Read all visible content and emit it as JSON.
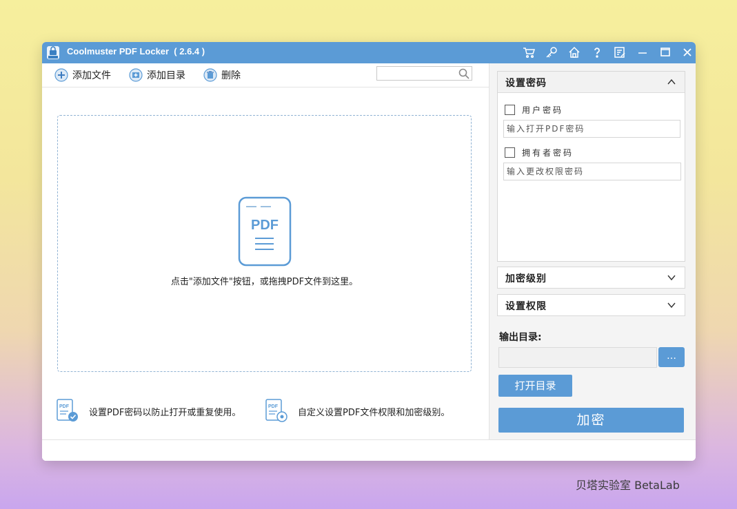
{
  "window": {
    "title": "Coolmuster PDF Locker  ( 2.6.4 )"
  },
  "titlebar_icons": [
    "cart-icon",
    "key-icon",
    "home-icon",
    "help-icon",
    "feedback-icon",
    "minimize-icon",
    "maximize-icon",
    "close-icon"
  ],
  "toolbar": {
    "add_file": "添加文件",
    "add_folder": "添加目录",
    "delete": "删除",
    "search_placeholder": ""
  },
  "dropzone": {
    "pdf_label": "PDF",
    "hint": "点击\"添加文件\"按钮，或拖拽PDF文件到这里。"
  },
  "features": [
    {
      "text": "设置PDF密码以防止打开或重复使用。"
    },
    {
      "text": "自定义设置PDF文件权限和加密级别。"
    }
  ],
  "panels": {
    "set_password": {
      "title": "设置密码",
      "user_password_label": "用户密码",
      "user_password_placeholder": "输入打开PDF密码",
      "owner_password_label": "拥有者密码",
      "owner_password_placeholder": "输入更改权限密码"
    },
    "encryption_level": {
      "title": "加密级别"
    },
    "permissions": {
      "title": "设置权限"
    }
  },
  "output": {
    "label": "输出目录:",
    "value": "",
    "browse_label": "…",
    "open_folder_label": "打开目录",
    "encrypt_label": "加密"
  },
  "watermark": "贝塔实验室 BetaLab",
  "colors": {
    "accent": "#5b9bd6",
    "panel_bg": "#f4f4f4"
  }
}
